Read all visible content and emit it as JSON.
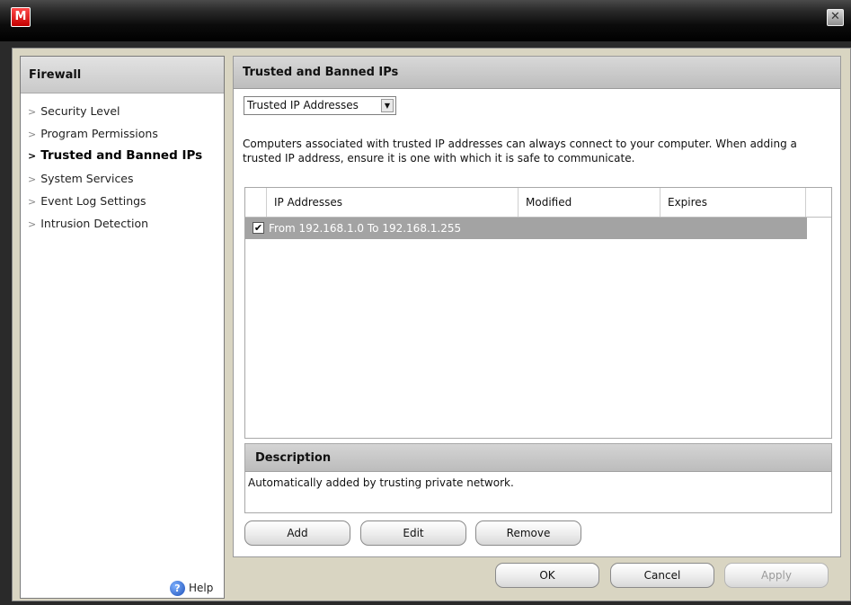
{
  "window": {
    "logo_letter": "M",
    "close_glyph": "✕",
    "accent_color": "#c40000"
  },
  "sidebar": {
    "title": "Firewall",
    "items": [
      {
        "label": "Security Level",
        "active": false
      },
      {
        "label": "Program Permissions",
        "active": false
      },
      {
        "label": "Trusted and Banned IPs",
        "active": true
      },
      {
        "label": "System Services",
        "active": false
      },
      {
        "label": "Event Log Settings",
        "active": false
      },
      {
        "label": "Intrusion Detection",
        "active": false
      }
    ],
    "help_label": "Help",
    "help_icon": "help-question-icon"
  },
  "main": {
    "title": "Trusted and Banned IPs",
    "dropdown_value": "Trusted IP Addresses",
    "info_text": "Computers associated with trusted IP addresses can always connect to your computer. When adding a trusted IP address, ensure it is one with which it is safe to communicate.",
    "table": {
      "columns": [
        "IP Addresses",
        "Modified",
        "Expires"
      ],
      "rows": [
        {
          "checked": true,
          "ip_range": "From 192.168.1.0 To 192.168.1.255",
          "modified": "",
          "expires": ""
        }
      ]
    },
    "description": {
      "title": "Description",
      "text": "Automatically added by trusting private network."
    },
    "buttons": {
      "add": "Add",
      "edit": "Edit",
      "remove": "Remove"
    }
  },
  "footer": {
    "ok": "OK",
    "cancel": "Cancel",
    "apply": "Apply"
  }
}
